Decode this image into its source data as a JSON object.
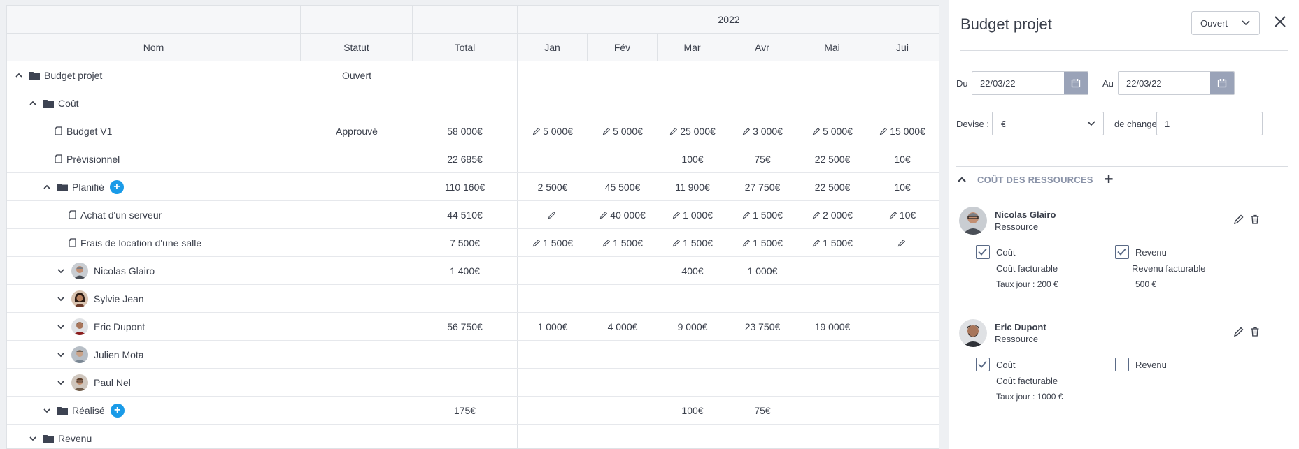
{
  "grid": {
    "year": "2022",
    "columns": {
      "nom": "Nom",
      "statut": "Statut",
      "total": "Total"
    },
    "months": [
      "Jan",
      "Fév",
      "Mar",
      "Avr",
      "Mai",
      "Jui"
    ],
    "rows": [
      {
        "name": "Budget projet",
        "statut": "Ouvert",
        "total": "",
        "m": [
          "",
          "",
          "",
          "",
          "",
          ""
        ]
      },
      {
        "name": "Coût",
        "statut": "",
        "total": "",
        "m": [
          "",
          "",
          "",
          "",
          "",
          ""
        ]
      },
      {
        "name": "Budget V1",
        "statut": "Approuvé",
        "total": "58 000€",
        "m": [
          "5 000€",
          "5 000€",
          "25 000€",
          "3 000€",
          "5 000€",
          "15 000€"
        ]
      },
      {
        "name": "Prévisionnel",
        "statut": "",
        "total": "22 685€",
        "m": [
          "",
          "",
          "100€",
          "75€",
          "22 500€",
          "10€"
        ]
      },
      {
        "name": "Planifié",
        "statut": "",
        "total": "110 160€",
        "m": [
          "2 500€",
          "45 500€",
          "11 900€",
          "27 750€",
          "22 500€",
          "10€"
        ]
      },
      {
        "name": "Achat d'un serveur",
        "statut": "",
        "total": "44 510€",
        "m": [
          "",
          "40 000€",
          "1 000€",
          "1 500€",
          "2 000€",
          "10€"
        ]
      },
      {
        "name": "Frais de location d'une salle",
        "statut": "",
        "total": "7 500€",
        "m": [
          "1 500€",
          "1 500€",
          "1 500€",
          "1 500€",
          "1 500€",
          ""
        ]
      },
      {
        "name": "Nicolas Glairo",
        "statut": "",
        "total": "1 400€",
        "m": [
          "",
          "",
          "400€",
          "1 000€",
          "",
          ""
        ]
      },
      {
        "name": "Sylvie Jean",
        "statut": "",
        "total": "",
        "m": [
          "",
          "",
          "",
          "",
          "",
          ""
        ]
      },
      {
        "name": "Eric Dupont",
        "statut": "",
        "total": "56 750€",
        "m": [
          "1 000€",
          "4 000€",
          "9 000€",
          "23 750€",
          "19 000€",
          ""
        ]
      },
      {
        "name": "Julien Mota",
        "statut": "",
        "total": "",
        "m": [
          "",
          "",
          "",
          "",
          "",
          ""
        ]
      },
      {
        "name": "Paul Nel",
        "statut": "",
        "total": "",
        "m": [
          "",
          "",
          "",
          "",
          "",
          ""
        ]
      },
      {
        "name": "Réalisé",
        "statut": "",
        "total": "175€",
        "m": [
          "",
          "",
          "100€",
          "75€",
          "",
          ""
        ]
      },
      {
        "name": "Revenu",
        "statut": "",
        "total": "",
        "m": [
          "",
          "",
          "",
          "",
          "",
          ""
        ]
      }
    ],
    "plus_symbol": "+"
  },
  "panel": {
    "title": "Budget projet",
    "status": "Ouvert",
    "du_label": "Du",
    "du_value": "22/03/22",
    "au_label": "Au",
    "au_value": "22/03/22",
    "devise_label": "Devise :",
    "devise_value": "€",
    "change_label": "de change :",
    "change_value": "1",
    "section_title": "COÛT DES RESSOURCES",
    "section_plus": "+",
    "resources": [
      {
        "name": "Nicolas Glairo",
        "role": "Ressource",
        "cout_label": "Coût",
        "cout_fact": "Coût facturable",
        "taux": "Taux jour :  200  €",
        "revenu_label": "Revenu",
        "revenu_fact": "Revenu facturable",
        "revenu_val": "500  €"
      },
      {
        "name": "Eric Dupont",
        "role": "Ressource",
        "cout_label": "Coût",
        "cout_fact": "Coût facturable",
        "taux": "Taux jour :  1000  €",
        "revenu_label": "Revenu"
      }
    ]
  },
  "colors": {
    "accent": "#1a9be8",
    "calendar_button": "#9aa3b8",
    "section_header": "#8a93a8"
  }
}
